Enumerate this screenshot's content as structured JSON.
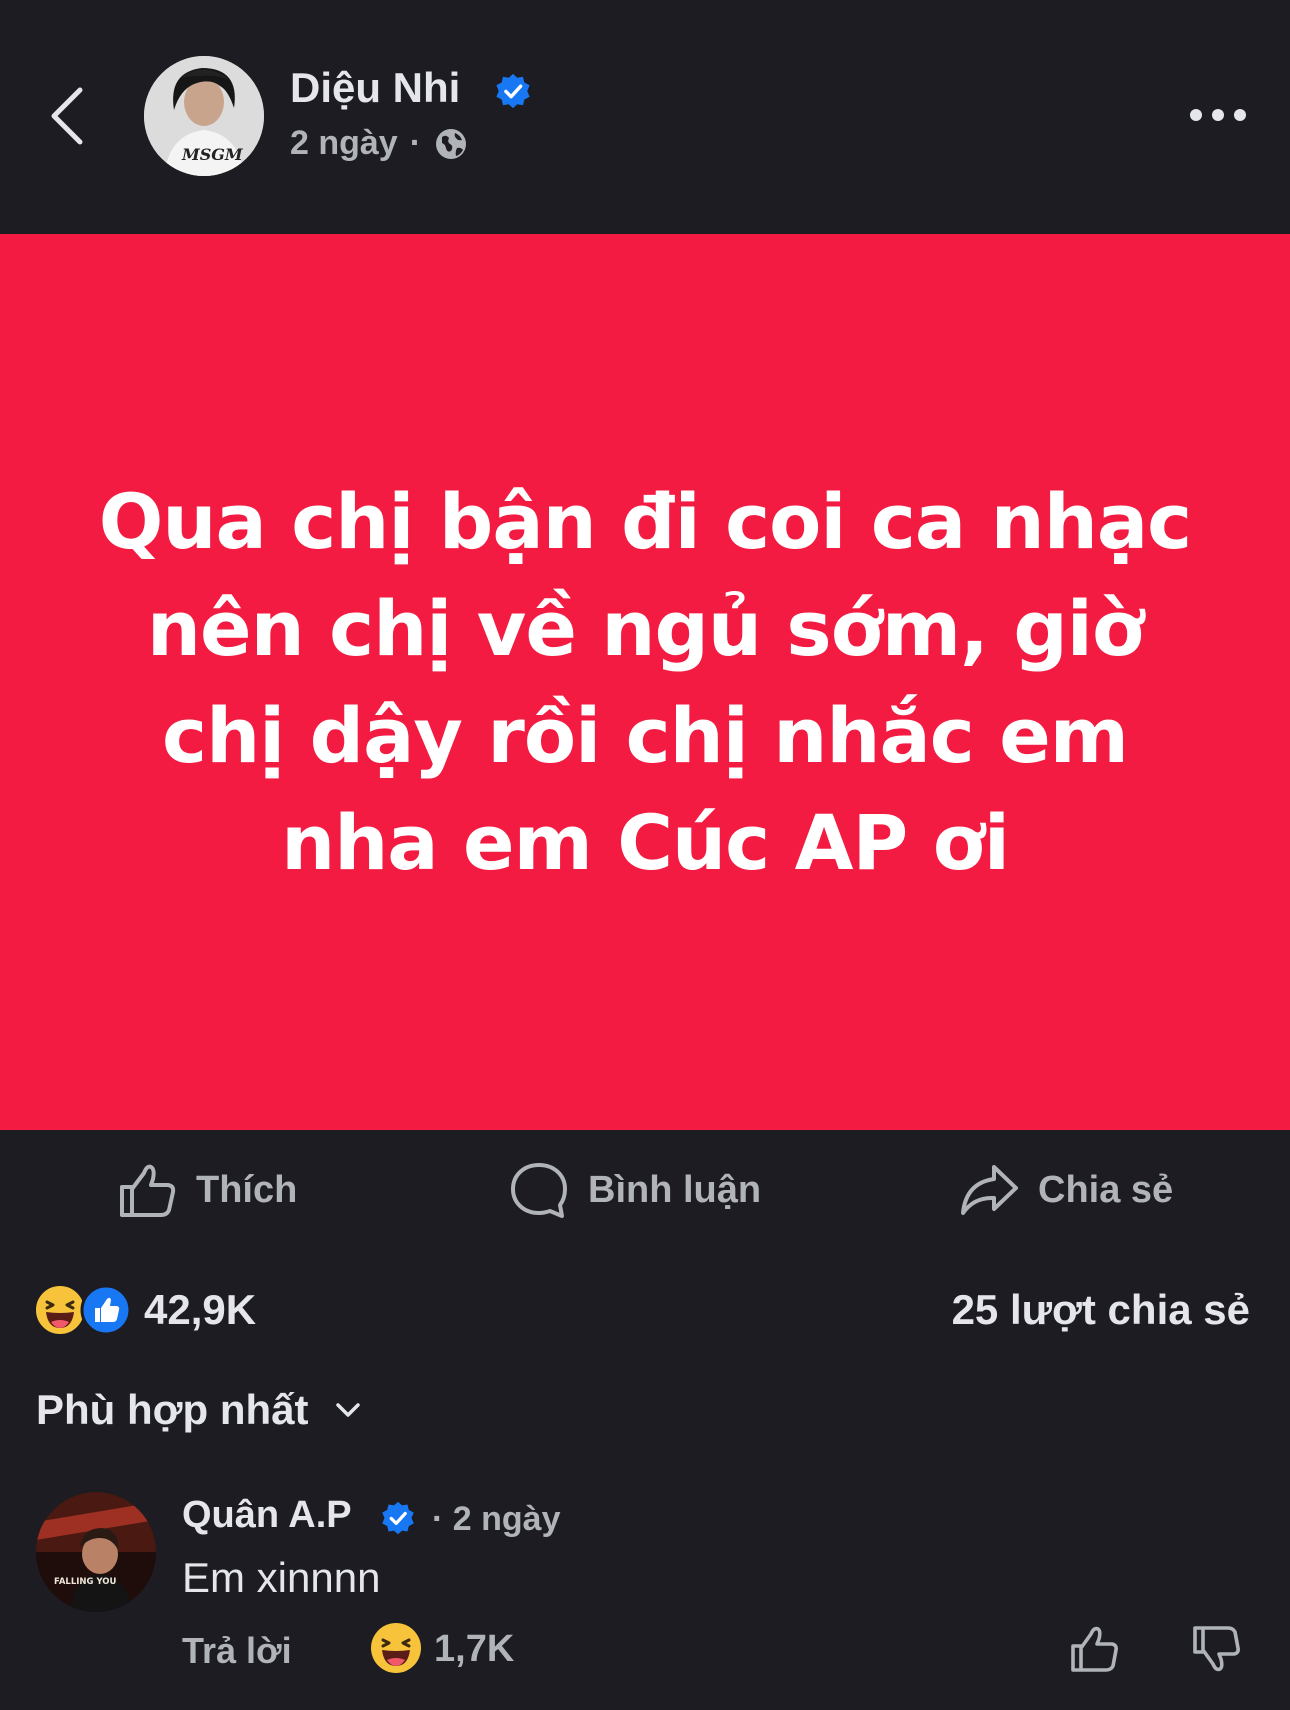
{
  "header": {
    "author_name": "Diệu Nhi",
    "post_time": "2 ngày",
    "separator": "·",
    "avatar_shirt_text": "MSGM"
  },
  "post": {
    "text": "Qua chị bận đi coi ca nhạc nên chị về ngủ sớm, giờ chị dậy rồi chị nhắc em nha em Cúc AP ơi",
    "background_color": "#f31b41",
    "text_color": "#ffffff"
  },
  "actions": {
    "like_label": "Thích",
    "comment_label": "Bình luận",
    "share_label": "Chia sẻ"
  },
  "stats": {
    "reaction_count": "42,9K",
    "share_count": "25 lượt chia sẻ",
    "reactions": [
      "haha-icon",
      "like-icon"
    ]
  },
  "sort": {
    "label": "Phù hợp nhất"
  },
  "comment": {
    "author": "Quân A.P",
    "time": "· 2 ngày",
    "text": "Em xinnnn",
    "reply_label": "Trả lời",
    "reaction_count": "1,7K",
    "avatar_text": "FALLING YOU"
  },
  "colors": {
    "background": "#1c1c22",
    "post_card": "#f31b41",
    "verified": "#1877f2",
    "secondary_text": "#b0b3b8"
  }
}
